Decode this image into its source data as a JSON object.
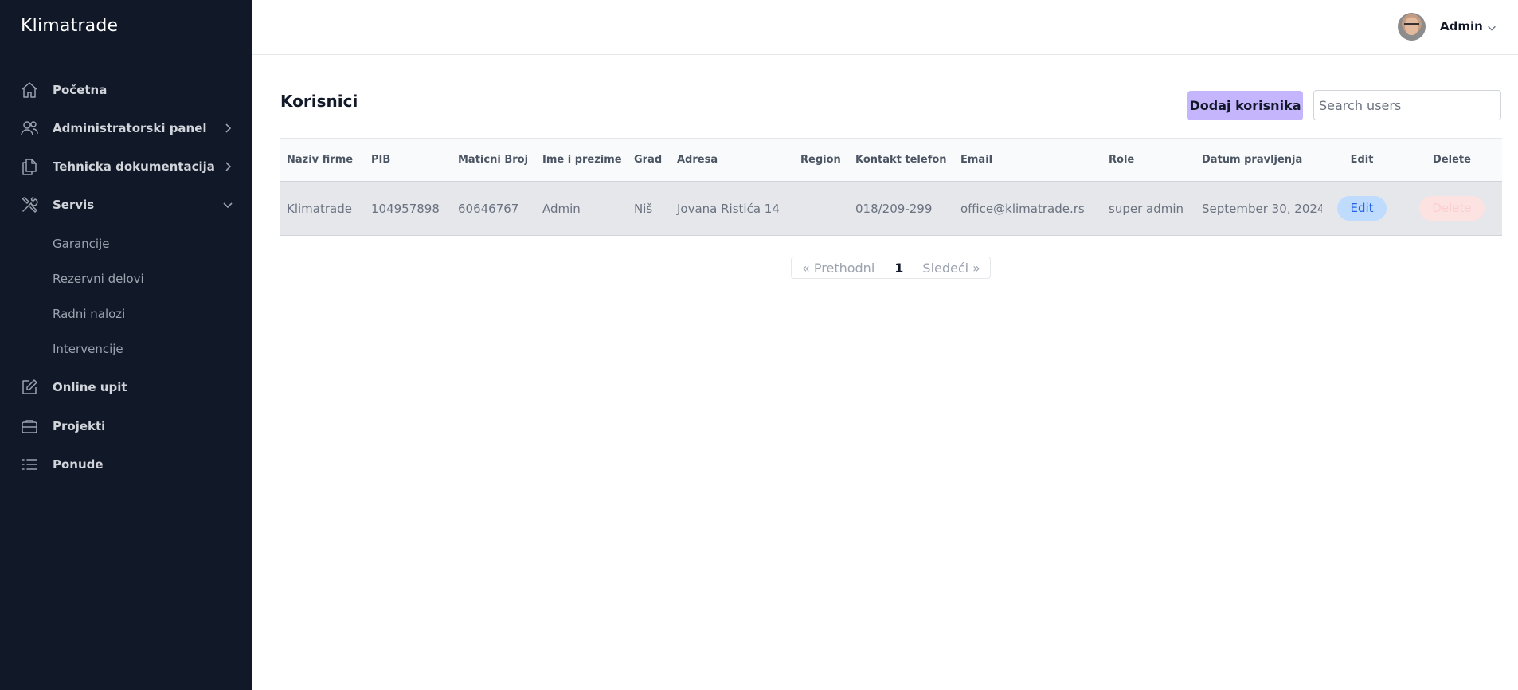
{
  "app": {
    "brand": "Klimatrade"
  },
  "sidebar": {
    "items": [
      {
        "label": "Početna",
        "icon": "home-icon"
      },
      {
        "label": "Administratorski panel",
        "icon": "users-icon",
        "chevron": "chevron-right-icon"
      },
      {
        "label": "Tehnicka dokumentacija",
        "icon": "documents-icon",
        "chevron": "chevron-right-icon"
      },
      {
        "label": "Servis",
        "icon": "tools-icon",
        "chevron": "chevron-down-icon",
        "expanded": true
      },
      {
        "label": "Online upit",
        "icon": "edit-icon"
      },
      {
        "label": "Projekti",
        "icon": "briefcase-icon"
      },
      {
        "label": "Ponude",
        "icon": "list-icon"
      }
    ],
    "servis_children": [
      {
        "label": "Garancije"
      },
      {
        "label": "Rezervni delovi"
      },
      {
        "label": "Radni nalozi"
      },
      {
        "label": "Intervencije"
      }
    ]
  },
  "header": {
    "user_name": "Admin",
    "avatar_icon": "user-avatar",
    "chevron_icon": "chevron-down-icon"
  },
  "main": {
    "title": "Korisnici",
    "add_button": "Dodaj korisnika",
    "search": {
      "placeholder": "Search users",
      "value": ""
    },
    "table": {
      "headers": [
        "Naziv firme",
        "PIB",
        "Maticni Broj",
        "Ime i prezime",
        "Grad",
        "Adresa",
        "Region",
        "Kontakt telefon",
        "Email",
        "Role",
        "Datum pravljenja",
        "Edit",
        "Delete"
      ],
      "rows": [
        {
          "naziv_firme": "Klimatrade",
          "pib": "104957898",
          "maticni_broj": "60646767",
          "ime_prezime": "Admin",
          "grad": "Niš",
          "adresa": "Jovana Ristića 14",
          "region": "",
          "kontakt_telefon": "018/209-299",
          "email": "office@klimatrade.rs",
          "role": "super admin",
          "datum": "September 30, 2024",
          "edit_label": "Edit",
          "delete_label": "Delete"
        }
      ]
    },
    "pagination": {
      "prev": "« Prethodni",
      "current": "1",
      "next": "Sledeći »"
    }
  },
  "colors": {
    "sidebar_bg": "#111827",
    "add_button_bg": "#c4b5fd",
    "edit_pill_bg": "#bfdbfe",
    "delete_pill_bg": "#fde2e2"
  }
}
